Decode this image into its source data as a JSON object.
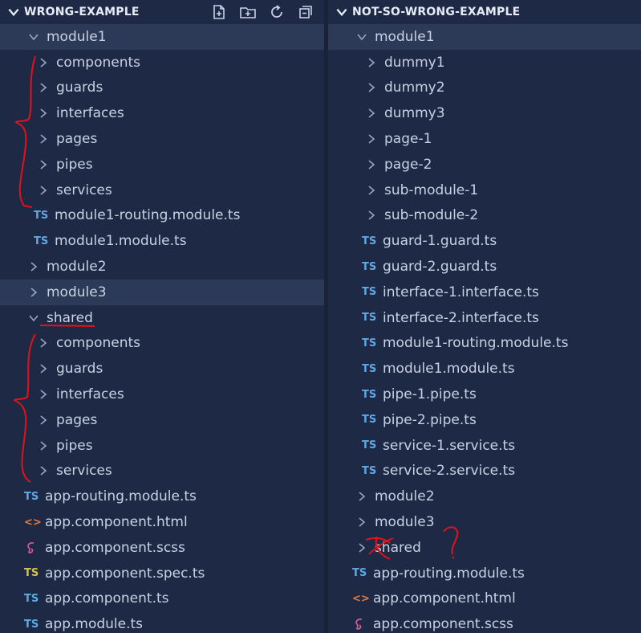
{
  "left": {
    "title": "WRONG-EXAMPLE",
    "actions": [
      "new-file-icon",
      "new-folder-icon",
      "refresh-icon",
      "collapse-all-icon"
    ],
    "rows": [
      {
        "label": "module1",
        "type": "folder",
        "open": true,
        "depth": 1,
        "sel": true
      },
      {
        "label": "components",
        "type": "folder",
        "depth": 2
      },
      {
        "label": "guards",
        "type": "folder",
        "depth": 2
      },
      {
        "label": "interfaces",
        "type": "folder",
        "depth": 2
      },
      {
        "label": "pages",
        "type": "folder",
        "depth": 2
      },
      {
        "label": "pipes",
        "type": "folder",
        "depth": 2
      },
      {
        "label": "services",
        "type": "folder",
        "depth": 2
      },
      {
        "label": "module1-routing.module.ts",
        "type": "ts",
        "icon": "TS",
        "depth": 2
      },
      {
        "label": "module1.module.ts",
        "type": "ts",
        "icon": "TS",
        "depth": 2
      },
      {
        "label": "module2",
        "type": "folder",
        "depth": 1
      },
      {
        "label": "module3",
        "type": "folder",
        "depth": 1,
        "sel": true
      },
      {
        "label": "shared",
        "type": "folder",
        "open": true,
        "depth": 1
      },
      {
        "label": "components",
        "type": "folder",
        "depth": 2
      },
      {
        "label": "guards",
        "type": "folder",
        "depth": 2
      },
      {
        "label": "interfaces",
        "type": "folder",
        "depth": 2
      },
      {
        "label": "pages",
        "type": "folder",
        "depth": 2
      },
      {
        "label": "pipes",
        "type": "folder",
        "depth": 2
      },
      {
        "label": "services",
        "type": "folder",
        "depth": 2
      },
      {
        "label": "app-routing.module.ts",
        "type": "ts",
        "icon": "TS",
        "depth": 1
      },
      {
        "label": "app.component.html",
        "type": "html",
        "icon": "<>",
        "depth": 1
      },
      {
        "label": "app.component.scss",
        "type": "scss",
        "icon": "scss",
        "depth": 1
      },
      {
        "label": "app.component.spec.ts",
        "type": "tsy",
        "icon": "TS",
        "depth": 1
      },
      {
        "label": "app.component.ts",
        "type": "ts",
        "icon": "TS",
        "depth": 1
      },
      {
        "label": "app.module.ts",
        "type": "ts",
        "icon": "TS",
        "depth": 1
      }
    ]
  },
  "right": {
    "title": "NOT-SO-WRONG-EXAMPLE",
    "rows": [
      {
        "label": "module1",
        "type": "folder",
        "open": true,
        "depth": 1,
        "sel": true
      },
      {
        "label": "dummy1",
        "type": "folder",
        "depth": 2
      },
      {
        "label": "dummy2",
        "type": "folder",
        "depth": 2
      },
      {
        "label": "dummy3",
        "type": "folder",
        "depth": 2
      },
      {
        "label": "page-1",
        "type": "folder",
        "depth": 2
      },
      {
        "label": "page-2",
        "type": "folder",
        "depth": 2
      },
      {
        "label": "sub-module-1",
        "type": "folder",
        "depth": 2
      },
      {
        "label": "sub-module-2",
        "type": "folder",
        "depth": 2
      },
      {
        "label": "guard-1.guard.ts",
        "type": "ts",
        "icon": "TS",
        "depth": 2
      },
      {
        "label": "guard-2.guard.ts",
        "type": "ts",
        "icon": "TS",
        "depth": 2
      },
      {
        "label": "interface-1.interface.ts",
        "type": "ts",
        "icon": "TS",
        "depth": 2
      },
      {
        "label": "interface-2.interface.ts",
        "type": "ts",
        "icon": "TS",
        "depth": 2
      },
      {
        "label": "module1-routing.module.ts",
        "type": "ts",
        "icon": "TS",
        "depth": 2
      },
      {
        "label": "module1.module.ts",
        "type": "ts",
        "icon": "TS",
        "depth": 2
      },
      {
        "label": "pipe-1.pipe.ts",
        "type": "ts",
        "icon": "TS",
        "depth": 2
      },
      {
        "label": "pipe-2.pipe.ts",
        "type": "ts",
        "icon": "TS",
        "depth": 2
      },
      {
        "label": "service-1.service.ts",
        "type": "ts",
        "icon": "TS",
        "depth": 2
      },
      {
        "label": "service-2.service.ts",
        "type": "ts",
        "icon": "TS",
        "depth": 2
      },
      {
        "label": "module2",
        "type": "folder",
        "depth": 1
      },
      {
        "label": "module3",
        "type": "folder",
        "depth": 1
      },
      {
        "label": "shared",
        "type": "folder",
        "depth": 1
      },
      {
        "label": "app-routing.module.ts",
        "type": "ts",
        "icon": "TS",
        "depth": 1
      },
      {
        "label": "app.component.html",
        "type": "html",
        "icon": "<>",
        "depth": 1
      },
      {
        "label": "app.component.scss",
        "type": "scss",
        "icon": "scss",
        "depth": 1
      }
    ]
  },
  "colors": {
    "background": "#1e2a45",
    "selection": "#2c3a58",
    "ts": "#5fa8e8",
    "spec": "#d8c14a",
    "html": "#e77a3c",
    "scss": "#e25b9a",
    "annotation": "#e0121a"
  }
}
